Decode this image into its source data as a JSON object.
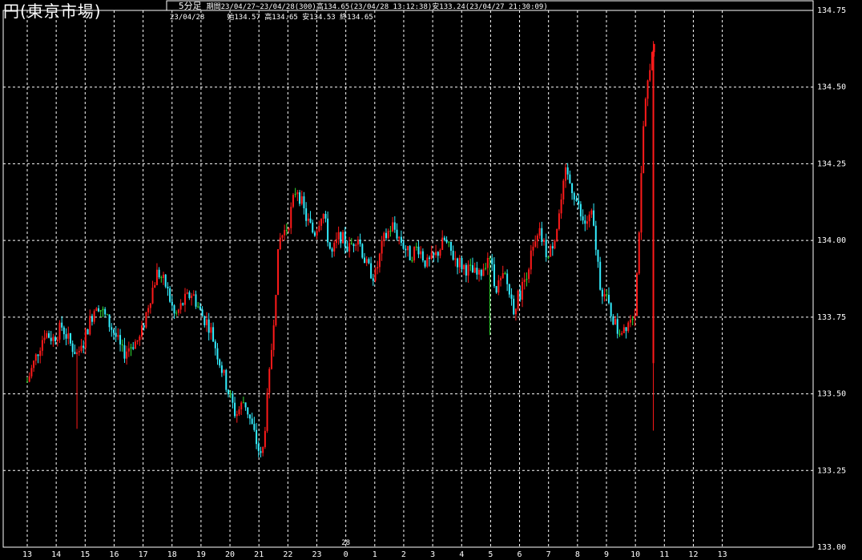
{
  "title": "円(東京市場)",
  "header": {
    "interval_label": "5分足",
    "period_line": "期間23/04/27~23/04/28(300)高134.65(23/04/28 13:12:38)安133.24(23/04/27 21:30:09)",
    "date": "23/04/28",
    "ohlc_line": "始134.57 高134.65 安134.53 終134.65"
  },
  "colors": {
    "up": "#ff1a1a",
    "down": "#33eeff",
    "neutral": "#33dd33",
    "grid": "#ffffff"
  },
  "chart_data": {
    "type": "candlestick",
    "ylim": [
      133.0,
      134.75
    ],
    "y_ticks": [
      "134.75",
      "134.50",
      "134.25",
      "134.00",
      "133.75",
      "133.50",
      "133.25",
      "133.00"
    ],
    "x_tick_labels": [
      "13",
      "14",
      "15",
      "16",
      "17",
      "18",
      "19",
      "20",
      "21",
      "22",
      "23",
      "0",
      "1",
      "2",
      "3",
      "4",
      "5",
      "6",
      "7",
      "8",
      "9",
      "10",
      "11",
      "12",
      "13"
    ],
    "date_marker": {
      "label": "28",
      "at": "0"
    },
    "path": [
      [
        0,
        133.54
      ],
      [
        0.3,
        133.62
      ],
      [
        0.6,
        133.7
      ],
      [
        0.9,
        133.68
      ],
      [
        1.2,
        133.72
      ],
      [
        1.5,
        133.66
      ],
      [
        1.8,
        133.62
      ],
      [
        2.1,
        133.72
      ],
      [
        2.4,
        133.8
      ],
      [
        2.7,
        133.75
      ],
      [
        3.0,
        133.7
      ],
      [
        3.3,
        133.63
      ],
      [
        3.6,
        133.66
      ],
      [
        3.9,
        133.68
      ],
      [
        4.2,
        133.8
      ],
      [
        4.5,
        133.9
      ],
      [
        4.8,
        133.85
      ],
      [
        5.1,
        133.75
      ],
      [
        5.4,
        133.8
      ],
      [
        5.7,
        133.83
      ],
      [
        6.0,
        133.76
      ],
      [
        6.3,
        133.72
      ],
      [
        6.6,
        133.62
      ],
      [
        6.9,
        133.52
      ],
      [
        7.2,
        133.43
      ],
      [
        7.5,
        133.48
      ],
      [
        7.8,
        133.38
      ],
      [
        8.1,
        133.28
      ],
      [
        8.4,
        133.6
      ],
      [
        8.7,
        134.0
      ],
      [
        9.0,
        134.05
      ],
      [
        9.3,
        134.18
      ],
      [
        9.6,
        134.08
      ],
      [
        9.9,
        134.02
      ],
      [
        10.2,
        134.1
      ],
      [
        10.5,
        133.95
      ],
      [
        10.8,
        134.02
      ],
      [
        11.1,
        133.97
      ],
      [
        11.4,
        134.02
      ],
      [
        11.7,
        133.92
      ],
      [
        12.0,
        133.88
      ],
      [
        12.3,
        134.0
      ],
      [
        12.6,
        134.05
      ],
      [
        12.9,
        134.0
      ],
      [
        13.2,
        133.95
      ],
      [
        13.5,
        133.98
      ],
      [
        13.8,
        133.92
      ],
      [
        14.1,
        133.95
      ],
      [
        14.4,
        134.0
      ],
      [
        14.7,
        133.95
      ],
      [
        15.0,
        133.92
      ],
      [
        15.3,
        133.9
      ],
      [
        15.6,
        133.88
      ],
      [
        15.9,
        133.95
      ],
      [
        16.2,
        133.85
      ],
      [
        16.5,
        133.88
      ],
      [
        16.8,
        133.78
      ],
      [
        17.1,
        133.85
      ],
      [
        17.4,
        133.95
      ],
      [
        17.7,
        134.02
      ],
      [
        18.0,
        133.94
      ],
      [
        18.3,
        134.05
      ],
      [
        18.6,
        134.22
      ],
      [
        18.9,
        134.15
      ],
      [
        19.2,
        134.05
      ],
      [
        19.5,
        134.08
      ],
      [
        19.8,
        133.85
      ],
      [
        20.1,
        133.78
      ],
      [
        20.4,
        133.7
      ],
      [
        20.7,
        133.73
      ],
      [
        21.0,
        133.78
      ],
      [
        21.3,
        134.4
      ],
      [
        21.5,
        134.58
      ],
      [
        21.65,
        134.62
      ]
    ]
  }
}
